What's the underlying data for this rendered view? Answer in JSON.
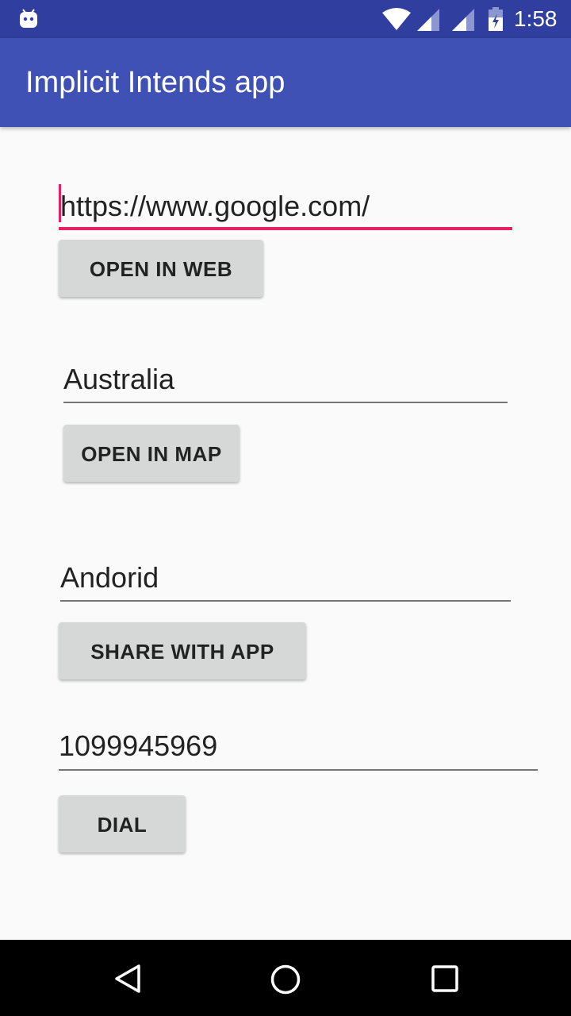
{
  "status_bar": {
    "time": "1:58",
    "icons": [
      "android-icon",
      "wifi-icon",
      "signal-icon",
      "signal-icon",
      "battery-icon"
    ]
  },
  "app_bar": {
    "title": "Implicit Intends app"
  },
  "form": {
    "url_value": "https://www.google.com/",
    "open_web_label": "OPEN IN WEB",
    "location_value": "Australia",
    "open_map_label": "OPEN IN MAP",
    "share_value": "Andorid",
    "share_label": "SHARE WITH APP",
    "phone_value": "1099945969",
    "dial_label": "DIAL"
  },
  "navigation": {
    "icons": [
      "back-icon",
      "home-icon",
      "recents-icon"
    ]
  },
  "colors": {
    "status_bar": "#303f9f",
    "app_bar": "#3f51b5",
    "accent": "#e91e63",
    "button": "#d6d7d7",
    "background": "#fafafa"
  }
}
